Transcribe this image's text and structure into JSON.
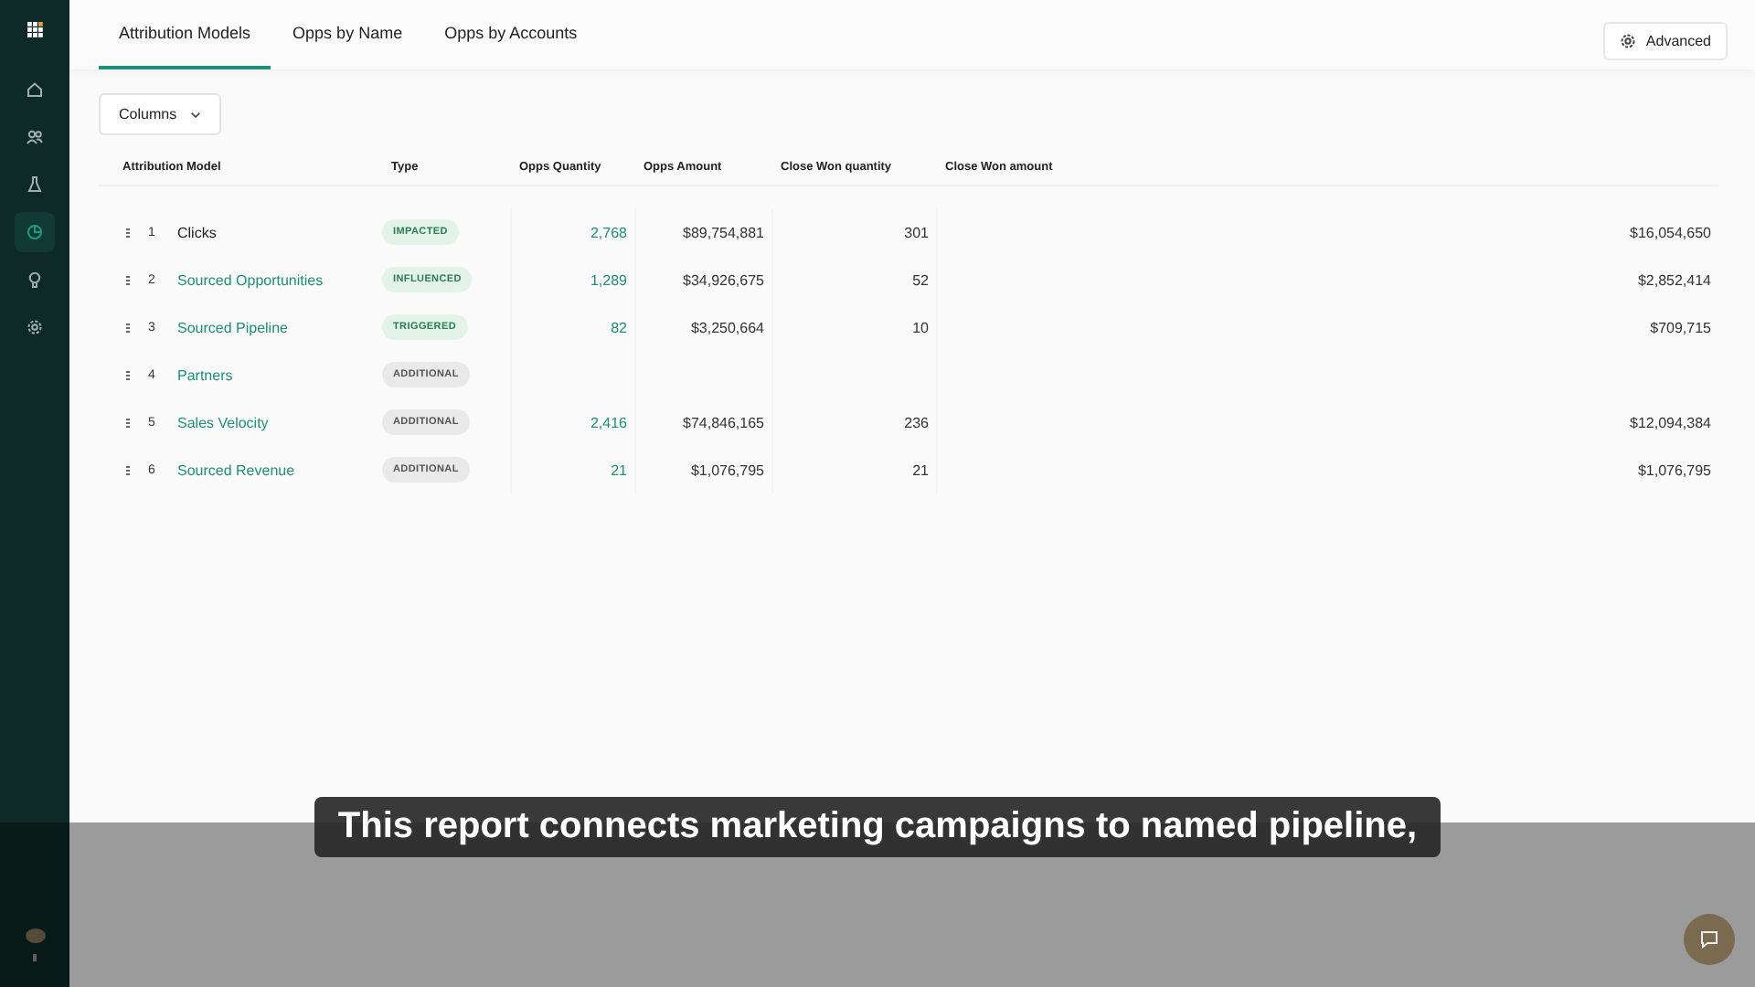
{
  "sidebar": {
    "items": [
      {
        "selected": false
      },
      {
        "selected": false
      },
      {
        "selected": false
      },
      {
        "selected": true
      },
      {
        "selected": false
      },
      {
        "selected": false
      }
    ]
  },
  "tabs": [
    {
      "label": "Attribution Models",
      "selected": true
    },
    {
      "label": "Opps by Name",
      "selected": false
    },
    {
      "label": "Opps by Accounts",
      "selected": false
    }
  ],
  "advanced_button": "Advanced",
  "columns_button": "Columns",
  "table": {
    "columns": [
      "Attribution Model",
      "Type",
      "Opps Quantity",
      "Opps Amount",
      "Close Won quantity",
      "Close Won amount"
    ],
    "rows": [
      {
        "index": "1",
        "name": "Clicks",
        "link": false,
        "type": "IMPACTED",
        "kind": "positive",
        "opps_quantity": "2,768",
        "opps_amount": "$89,754,881",
        "close_won_quantity": "301",
        "close_won_amount": "$16,054,650"
      },
      {
        "index": "2",
        "name": "Sourced Opportunities",
        "link": true,
        "type": "INFLUENCED",
        "kind": "positive",
        "opps_quantity": "1,289",
        "opps_amount": "$34,926,675",
        "close_won_quantity": "52",
        "close_won_amount": "$2,852,414"
      },
      {
        "index": "3",
        "name": "Sourced Pipeline",
        "link": true,
        "type": "TRIGGERED",
        "kind": "positive",
        "opps_quantity": "82",
        "opps_amount": "$3,250,664",
        "close_won_quantity": "10",
        "close_won_amount": "$709,715"
      },
      {
        "index": "4",
        "name": "Partners",
        "link": true,
        "type": "ADDITIONAL",
        "kind": "neutral"
      },
      {
        "index": "5",
        "name": "Sales Velocity",
        "link": true,
        "type": "ADDITIONAL",
        "kind": "neutral",
        "opps_quantity": "2,416",
        "opps_amount": "$74,846,165",
        "close_won_quantity": "236",
        "close_won_amount": "$12,094,384"
      },
      {
        "index": "6",
        "name": "Sourced Revenue",
        "link": true,
        "type": "ADDITIONAL",
        "kind": "neutral",
        "opps_quantity": "21",
        "opps_amount": "$1,076,795",
        "close_won_quantity": "21",
        "close_won_amount": "$1,076,795"
      }
    ]
  },
  "caption": "This report connects marketing campaigns to named pipeline,"
}
